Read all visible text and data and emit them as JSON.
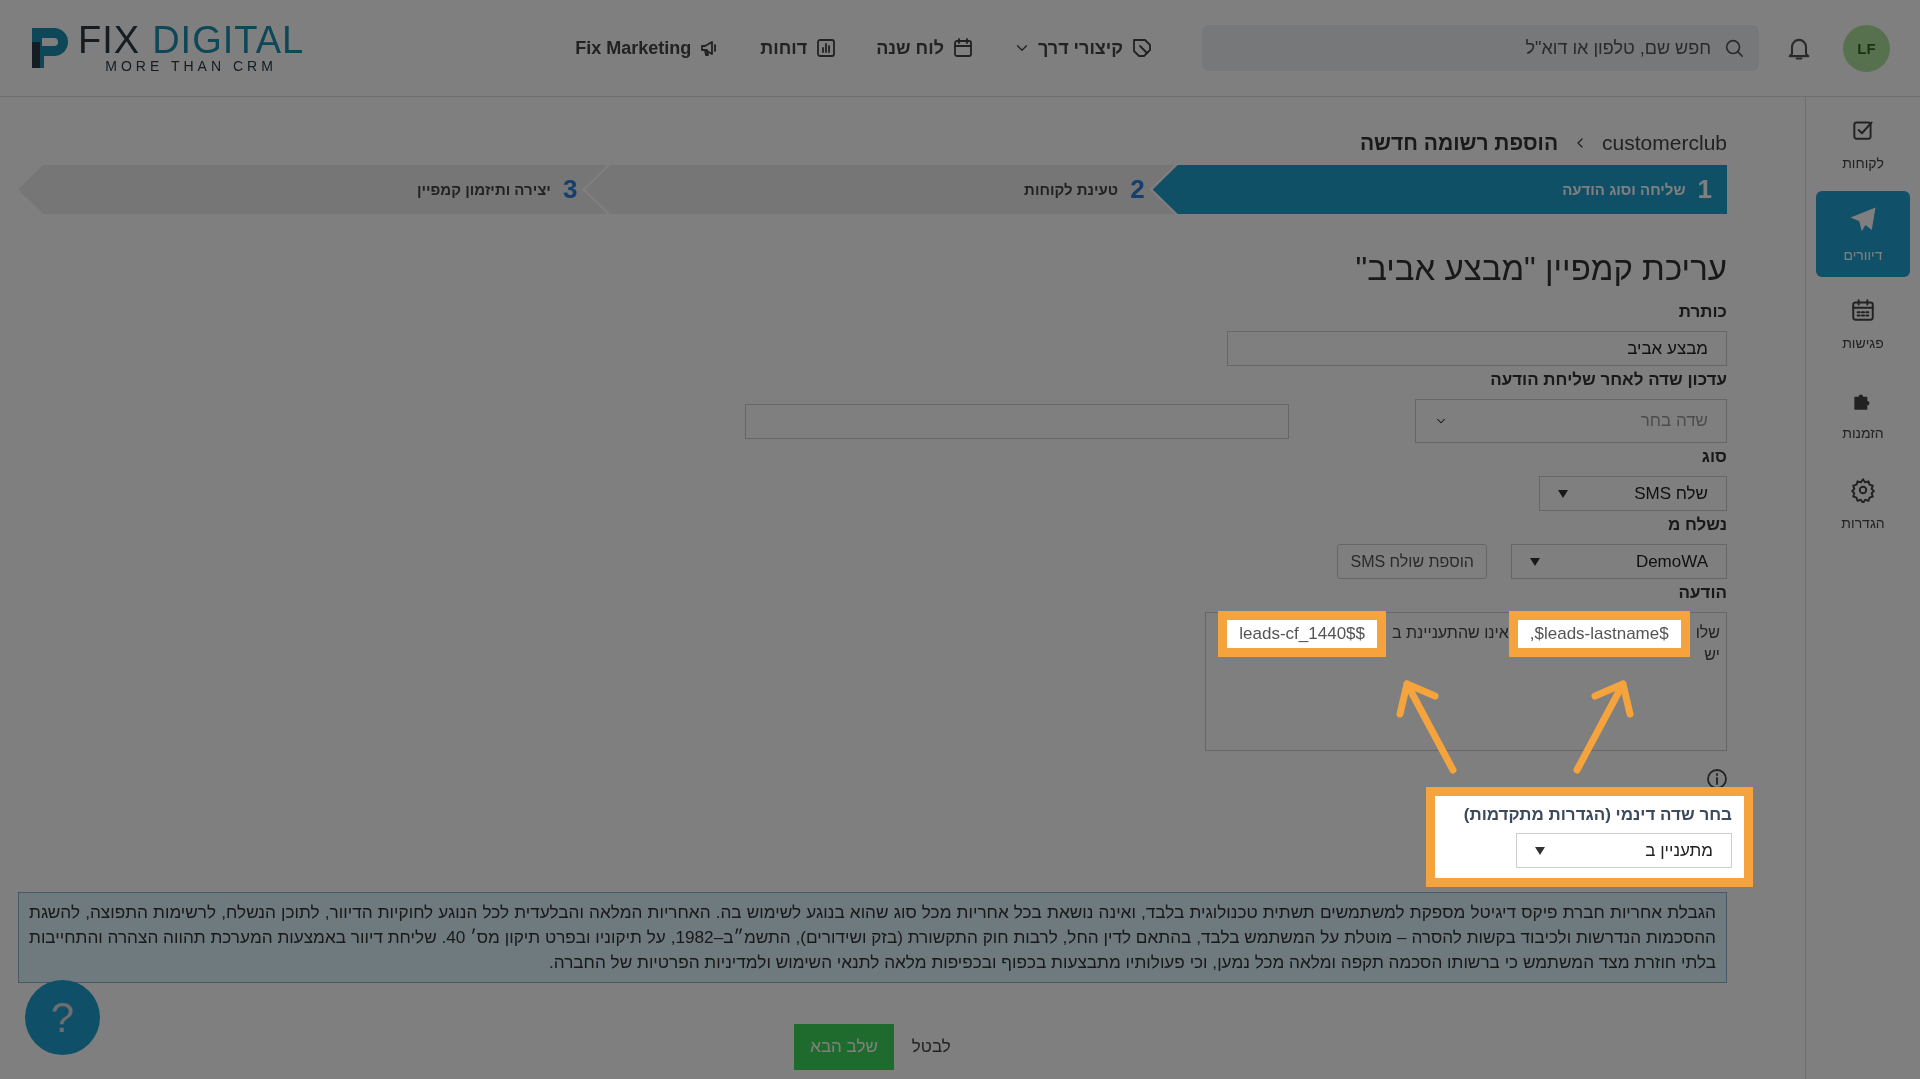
{
  "header": {
    "logo": {
      "word_1": "FIX",
      "word_2": "DIGITAL",
      "tagline": "MORE THAN CRM"
    },
    "nav": [
      {
        "label": "קיצורי דרך",
        "has_menu": true
      },
      {
        "label": "לוח שנה",
        "has_menu": false
      },
      {
        "label": "דוחות",
        "has_menu": false
      },
      {
        "label": "Fix Marketing",
        "has_menu": false
      }
    ],
    "search": {
      "placeholder": "חפש שם, טלפון או דוא\"ל"
    },
    "avatar": {
      "initials": "LF"
    }
  },
  "sidebar": {
    "items": [
      {
        "label": "לקוחות",
        "selected": false
      },
      {
        "label": "דיוורים",
        "selected": true
      },
      {
        "label": "פגישות",
        "selected": false
      },
      {
        "label": "הזמנות",
        "selected": false
      },
      {
        "label": "הגדרות",
        "selected": false
      }
    ]
  },
  "breadcrumb": [
    "customerclub",
    "הוספת רשומה חדשה"
  ],
  "steps": [
    {
      "number": "1",
      "label": "שליחה וסוג הודעה",
      "selected": true
    },
    {
      "number": "2",
      "label": "טעינת לקוחות",
      "selected": false
    },
    {
      "number": "3",
      "label": "יצירה ותיזמון קמפיין",
      "selected": false
    }
  ],
  "form": {
    "title": "עריכת קמפיין \"מבצע אביב\"",
    "title_field": {
      "label": "כותרת",
      "value": "מבצע אביב"
    },
    "update_field": {
      "label": "עדכון שדה לאחר שליחת הודעה",
      "placeholder": "שדה בחר"
    },
    "type_field": {
      "label": "סוג",
      "value": "שלח SMS"
    },
    "sender_field": {
      "label": "נשלח מ",
      "value": "DemoWA",
      "button": "הוספת שולח SMS"
    },
    "message": {
      "label": "הודעה",
      "lines": [
        {
          "parts": [
            {
              "text": "שלו",
              "highlighted": false
            },
            {
              "text": ",$leads-lastname$",
              "highlighted": true
            },
            {
              "text": "אינו שהתעניינת ב",
              "highlighted": false
            },
            {
              "text": "leads-cf_1440$$",
              "highlighted": true
            }
          ]
        },
        {
          "parts": [
            {
              "text": "יש",
              "highlighted": false
            }
          ]
        }
      ]
    },
    "dynamic_field": {
      "label": "בחר שדה דינמי (הגדרות מתקדמות)",
      "value": "מתעניין ב",
      "highlighted": true
    }
  },
  "disclaimer": "הגבלת אחריות חברת פיקס דיגיטל מספקת למשתמשים תשתית טכנולוגית בלבד, ואינה נושאת בכל אחריות מכל סוג שהוא בנוגע לשימוש בה. האחריות המלאה והבלעדית לכל הנוגע לחוקיות הדיוור, לתוכן הנשלח, לרשימות התפוצה, להשגת ההסכמות הנדרשות ולכיבוד בקשות להסרה – מוטלת על המשתמש בלבד, בהתאם לדין החל, לרבות חוק התקשורת (בזק ושידורים), התשמ״ב–1982, על תיקוניו ובפרט תיקון מס׳ 40. שליחת דיוור באמצעות המערכת תהווה הצהרה והתחייבות בלתי חוזרת מצד המשתמש כי ברשותו הסכמה תקפה ומלאה מכל נמען, וכי פעולותיו מתבצעות בכפוף ובכפיפות מלאה לתנאי השימוש ולמדיניות הפרטיות של החברה.",
  "footer": {
    "next": "שלב הבא",
    "cancel": "לבטל"
  },
  "help": {
    "label": "?"
  }
}
